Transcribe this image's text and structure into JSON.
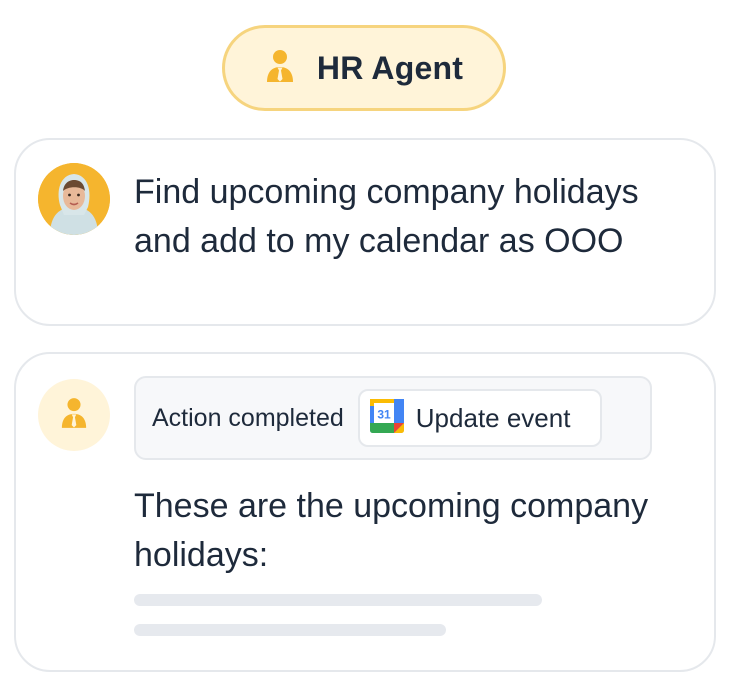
{
  "header": {
    "title": "HR Agent",
    "icon": "person-with-tie-icon"
  },
  "user_message": {
    "avatar": "user-avatar-photo",
    "text": "Find upcoming company holidays and add to my calendar as OOO"
  },
  "agent_message": {
    "avatar_icon": "person-with-tie-icon",
    "status": "Action completed",
    "action": {
      "icon": "google-calendar-icon",
      "calendar_day": "31",
      "label": "Update event"
    },
    "text": "These are the upcoming company holidays:"
  },
  "colors": {
    "accent": "#f5b52e",
    "pill_background": "#fff4d9",
    "pill_border": "#f6d47e",
    "border": "#e5e8ec",
    "text": "#1e2a3b",
    "skeleton": "#e6e9ee"
  }
}
